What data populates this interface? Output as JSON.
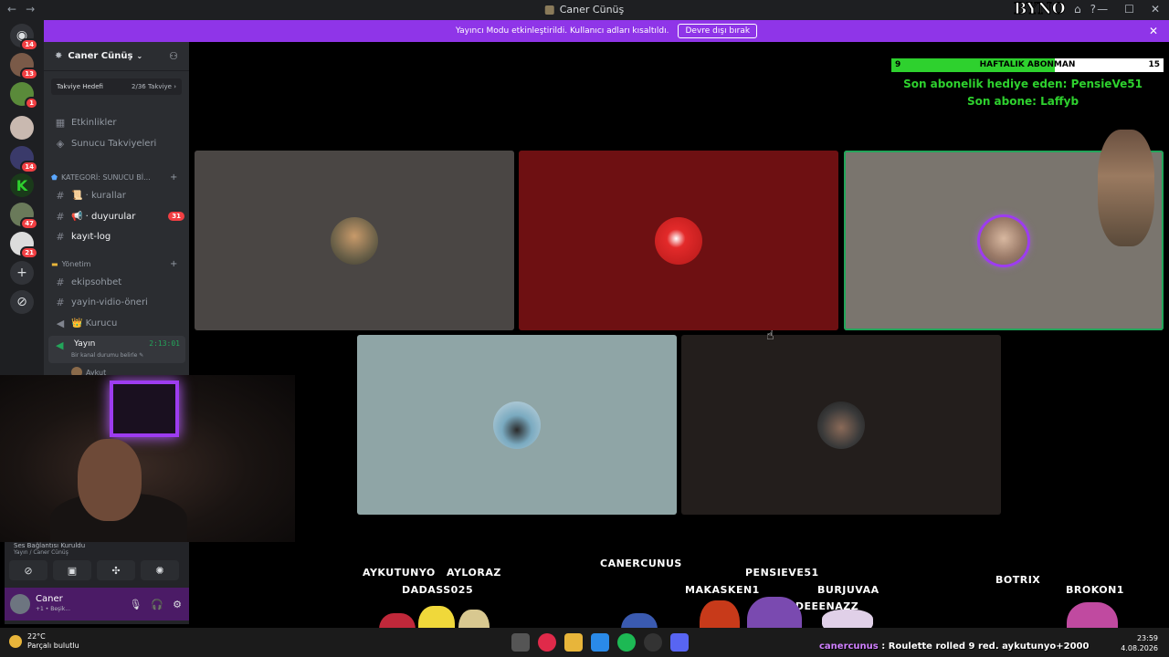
{
  "titlebar": {
    "title": "Caner Cünüş",
    "back": "←",
    "forward": "→",
    "minimize": "—",
    "maximize": "☐",
    "close": "✕"
  },
  "banner": {
    "message": "Yayıncı Modu etkinleştirildi. Kullanıcı adları kısaltıldı.",
    "button": "Devre dışı bırak",
    "close": "✕"
  },
  "rail": {
    "badges": [
      "14",
      "13",
      "1",
      "14",
      "47",
      "21"
    ],
    "add": "+",
    "discover": "⊘"
  },
  "server": {
    "name": "Caner Cünüş",
    "boost": {
      "label": "Takviye Hedefi",
      "count": "2/36 Takviye ›"
    },
    "items": [
      {
        "label": "Etkinlikler"
      },
      {
        "label": "Sunucu Takviyeleri"
      }
    ],
    "category1": "KATEGORİ: SUNUCU Bİ...",
    "channels1": [
      {
        "label": "📜 · kurallar"
      },
      {
        "label": "📢 · duyurular",
        "count": "31"
      },
      {
        "label": "kayıt-log"
      }
    ],
    "category2": "Yönetim",
    "channels2": [
      {
        "label": "ekipsohbet"
      },
      {
        "label": "yayin-vidio-öneri"
      },
      {
        "label": "👑 Kurucu"
      }
    ],
    "voice": {
      "name": "Yayın",
      "time": "2:13:01",
      "status": "Bir kanal durumu belirle ✎",
      "user": "Aykut"
    }
  },
  "vc_panel": {
    "status_title": "Ses Bağlantısı Kuruldu",
    "status_sub": "Yayın / Caner Cünüş",
    "user": {
      "name": "Caner",
      "sub": "+1 • Beşik..."
    }
  },
  "overlay": {
    "logo_text": "BYNO",
    "sub_goal": {
      "current": "9",
      "label": "HAFTALIK ABONMAN",
      "goal": "15",
      "progress": 0.6
    },
    "last_gift": "Son abonelik hediye eden: PensieVe51",
    "last_sub": "Son abone: Laffyb"
  },
  "chat_names": [
    "AYKUTUNYO",
    "AYLORAZ",
    "DADASS025",
    "CANERCUNUS",
    "MAKASKEN1",
    "PENSIEVE51",
    "BURJUVAA",
    "SUDEEENAZZ",
    "BOTRIX",
    "BROKON1"
  ],
  "roulette": "Roulette rolled 9 red. aykutunyo+2000",
  "roulette_user": "canercunus",
  "taskbar": {
    "temp": "22°C",
    "weather": "Parçalı bulutlu",
    "time": "23:59",
    "date": "4.08.2026"
  },
  "colors": {
    "accent": "#8f35e8",
    "speaking": "#23a55a",
    "sub_fill": "#2ed12e"
  }
}
